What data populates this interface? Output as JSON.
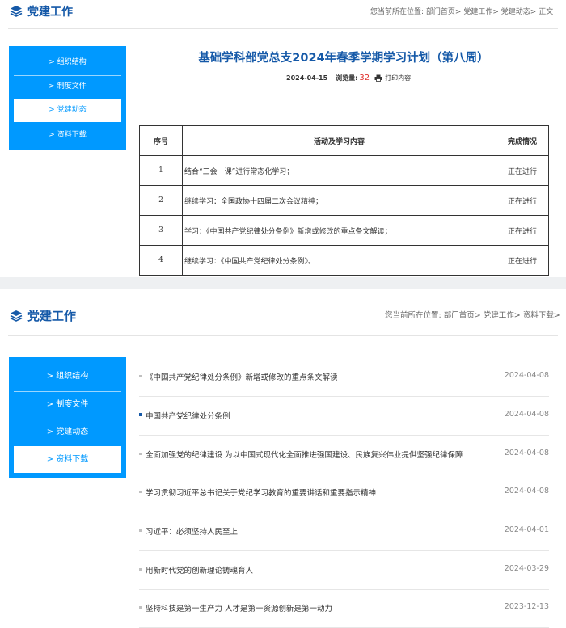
{
  "top": {
    "section_title": "党建工作",
    "breadcrumb": {
      "prefix": "您当前所在位置:",
      "items": [
        "部门首页>",
        "党建工作>",
        "党建动态>",
        "正文"
      ]
    },
    "sidebar": {
      "items": [
        {
          "label": "> 组织结构",
          "active": false
        },
        {
          "label": "> 制度文件",
          "active": false
        },
        {
          "label": "> 党建动态",
          "active": true
        },
        {
          "label": "> 资料下载",
          "active": false
        }
      ]
    },
    "article": {
      "title": "基础学科部党总支2024年春季学期学习计划（第八周）",
      "date": "2024-04-15",
      "views_label": "浏览量:",
      "views": "32",
      "print_label": "打印内容"
    },
    "table": {
      "headers": [
        "序号",
        "活动及学习内容",
        "完成情况"
      ],
      "rows": [
        [
          "1",
          "结合“三会一课”进行常态化学习；",
          "正在进行"
        ],
        [
          "2",
          "继续学习：全国政协十四届二次会议精神；",
          "正在进行"
        ],
        [
          "3",
          "学习：《中国共产党纪律处分条例》新增或修改的重点条文解读；",
          "正在进行"
        ],
        [
          "4",
          "继续学习：《中国共产党纪律处分条例》。",
          "正在进行"
        ]
      ]
    }
  },
  "bottom": {
    "section_title": "党建工作",
    "breadcrumb": {
      "prefix": "您当前所在位置:",
      "items": [
        "部门首页>",
        "党建工作>",
        "资料下载>"
      ]
    },
    "sidebar": {
      "items": [
        {
          "label": "> 组织结构",
          "active": false
        },
        {
          "label": "> 制度文件",
          "active": false
        },
        {
          "label": "> 党建动态",
          "active": false
        },
        {
          "label": "> 资料下载",
          "active": true
        }
      ]
    },
    "list": [
      {
        "title": "《中国共产党纪律处分条例》新增或修改的重点条文解读",
        "date": "2024-04-08",
        "highlight": false
      },
      {
        "title": "中国共产党纪律处分条例",
        "date": "2024-04-08",
        "highlight": true
      },
      {
        "title": "全面加强党的纪律建设 为以中国式现代化全面推进强国建设、民族复兴伟业提供坚强纪律保障",
        "date": "2024-04-08",
        "highlight": false
      },
      {
        "title": "学习贯彻习近平总书记关于党纪学习教育的重要讲话和重要指示精神",
        "date": "2024-04-08",
        "highlight": false
      },
      {
        "title": "习近平：必须坚持人民至上",
        "date": "2024-04-01",
        "highlight": false
      },
      {
        "title": "用新时代党的创新理论铸魂育人",
        "date": "2024-03-29",
        "highlight": false
      },
      {
        "title": "坚持科技是第一生产力 人才是第一资源创新是第一动力",
        "date": "2023-12-13",
        "highlight": false
      }
    ]
  },
  "colors": {
    "brand_blue": "#1559a8",
    "sidebar_blue": "#0099ff",
    "view_count_red": "#e0312d"
  },
  "icons": {
    "section": "layers-icon",
    "print": "printer-icon"
  }
}
